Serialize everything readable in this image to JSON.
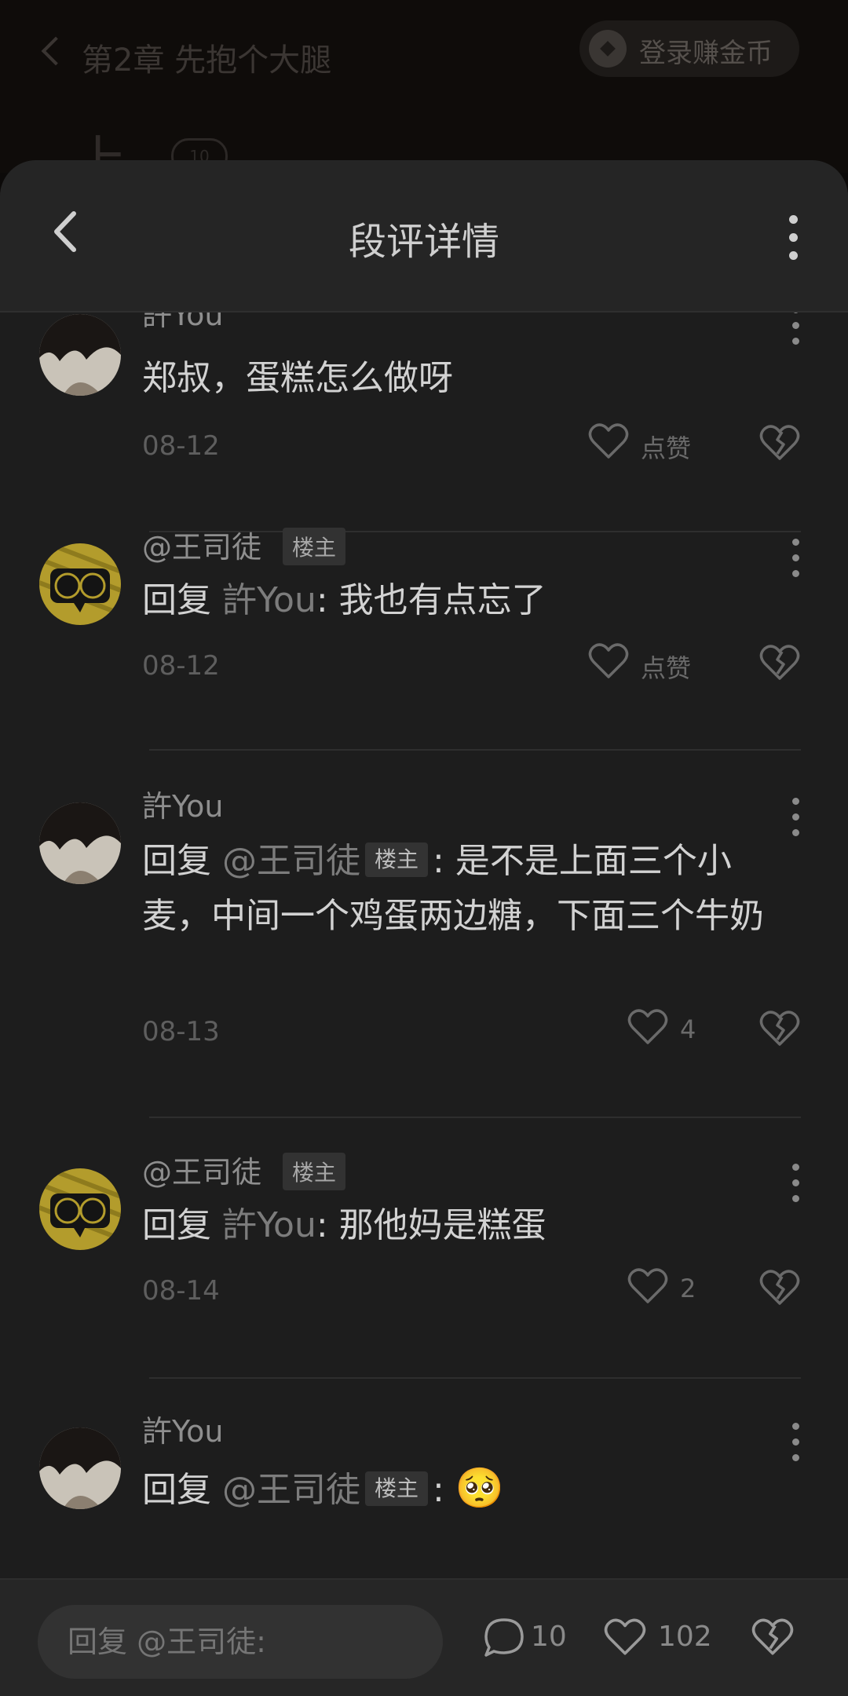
{
  "background": {
    "chapter_title": "第2章 先抱个大腿",
    "login_button": "登录赚金币",
    "partial_char": "上",
    "bubble_count": "10"
  },
  "header": {
    "title": "段评详情"
  },
  "comments": [
    {
      "name": "許You",
      "owner": false,
      "text": "郑叔，蛋糕怎么做呀",
      "date": "08-12",
      "like_label": "点赞"
    },
    {
      "name": "@王司徒",
      "owner": true,
      "owner_tag": "楼主",
      "reply_prefix": "回复",
      "reply_to": "許You",
      "text": ": 我也有点忘了",
      "date": "08-12",
      "like_label": "点赞"
    },
    {
      "name": "許You",
      "owner": false,
      "reply_prefix": "回复",
      "reply_to": "@王司徒",
      "reply_to_tag": "楼主",
      "text": ": 是不是上面三个小麦，中间一个鸡蛋两边糖，下面三个牛奶",
      "date": "08-13",
      "like_label": "4"
    },
    {
      "name": "@王司徒",
      "owner": true,
      "owner_tag": "楼主",
      "reply_prefix": "回复",
      "reply_to": "許You",
      "text": ": 那他妈是糕蛋",
      "date": "08-14",
      "like_label": "2"
    },
    {
      "name": "許You",
      "owner": false,
      "reply_prefix": "回复",
      "reply_to": "@王司徒",
      "reply_to_tag": "楼主",
      "text": ":",
      "emoji": "🥺"
    }
  ],
  "bottom_bar": {
    "reply_placeholder": "回复 @王司徒:",
    "comment_count": "10",
    "like_count": "102"
  },
  "icons": [
    "back-arrow-icon",
    "more-vertical-icon",
    "heart-icon",
    "broken-heart-icon",
    "comment-bubble-icon"
  ],
  "colors": {
    "sheet_bg": "#1d1d1d",
    "header_bg": "#252525",
    "owner_tag_bg": "#323232"
  }
}
